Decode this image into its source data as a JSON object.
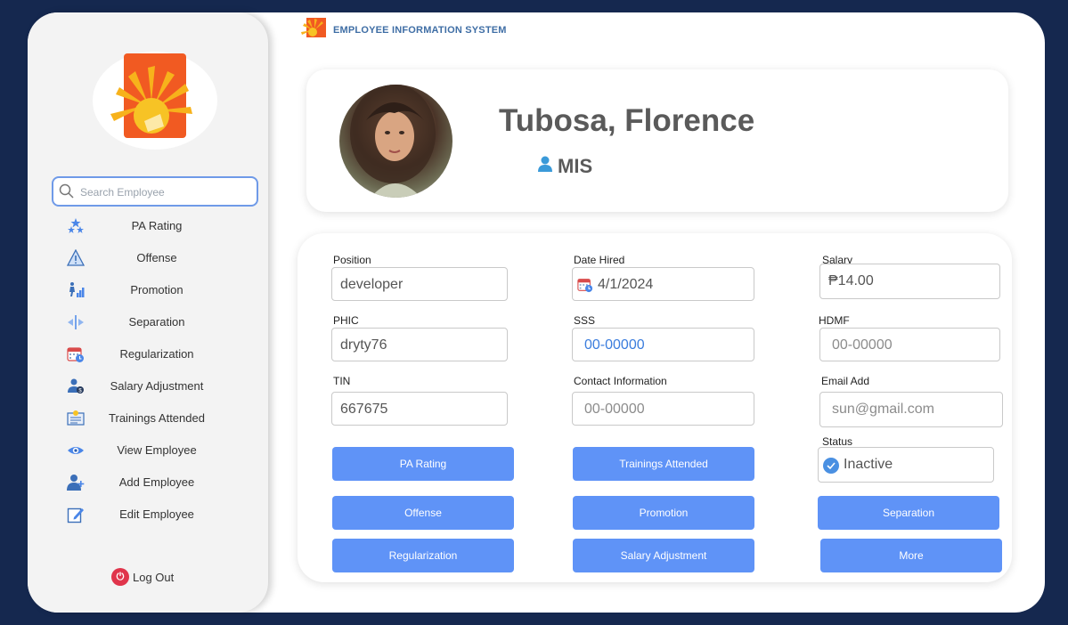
{
  "app": {
    "title": "EMPLOYEE INFORMATION SYSTEM"
  },
  "sidebar": {
    "search": {
      "placeholder": "Search Employee",
      "value": ""
    },
    "items": [
      {
        "label": "PA Rating",
        "icon": "stars-icon"
      },
      {
        "label": "Offense",
        "icon": "warning-icon"
      },
      {
        "label": "Promotion",
        "icon": "promotion-chart-icon"
      },
      {
        "label": "Separation",
        "icon": "separation-icon"
      },
      {
        "label": "Regularization",
        "icon": "calendar-clock-icon"
      },
      {
        "label": "Salary Adjustment",
        "icon": "user-money-icon"
      },
      {
        "label": "Trainings Attended",
        "icon": "training-board-icon"
      },
      {
        "label": "View Employee",
        "icon": "eye-icon"
      },
      {
        "label": "Add Employee",
        "icon": "add-user-icon"
      },
      {
        "label": "Edit Employee",
        "icon": "edit-icon"
      }
    ],
    "logout_label": "Log Out"
  },
  "profile": {
    "name": "Tubosa, Florence",
    "department": "MIS"
  },
  "fields": {
    "position": {
      "label": "Position",
      "value": "developer"
    },
    "date_hired": {
      "label": "Date Hired",
      "value": "4/1/2024"
    },
    "salary": {
      "label": "Salary",
      "value": "₱14.00"
    },
    "phic": {
      "label": "PHIC",
      "value": "dryty76"
    },
    "sss": {
      "label": "SSS",
      "value": "00-00000"
    },
    "hdmf": {
      "label": "HDMF",
      "placeholder": "00-00000"
    },
    "tin": {
      "label": "TIN",
      "value": "667675"
    },
    "contact": {
      "label": "Contact Information",
      "placeholder": "00-00000"
    },
    "email": {
      "label": "Email Add",
      "placeholder": "sun@gmail.com"
    },
    "status": {
      "label": "Status",
      "value": "Inactive"
    }
  },
  "buttons": {
    "pa_rating": "PA Rating",
    "trainings": "Trainings Attended",
    "offense": "Offense",
    "promotion": "Promotion",
    "separation": "Separation",
    "regularization": "Regularization",
    "salary_adjustment": "Salary Adjustment",
    "more": "More"
  },
  "colors": {
    "background": "#15284f",
    "accent": "#5f93f7",
    "search_border": "#6f9ae8",
    "logo_orange": "#f15a22"
  }
}
